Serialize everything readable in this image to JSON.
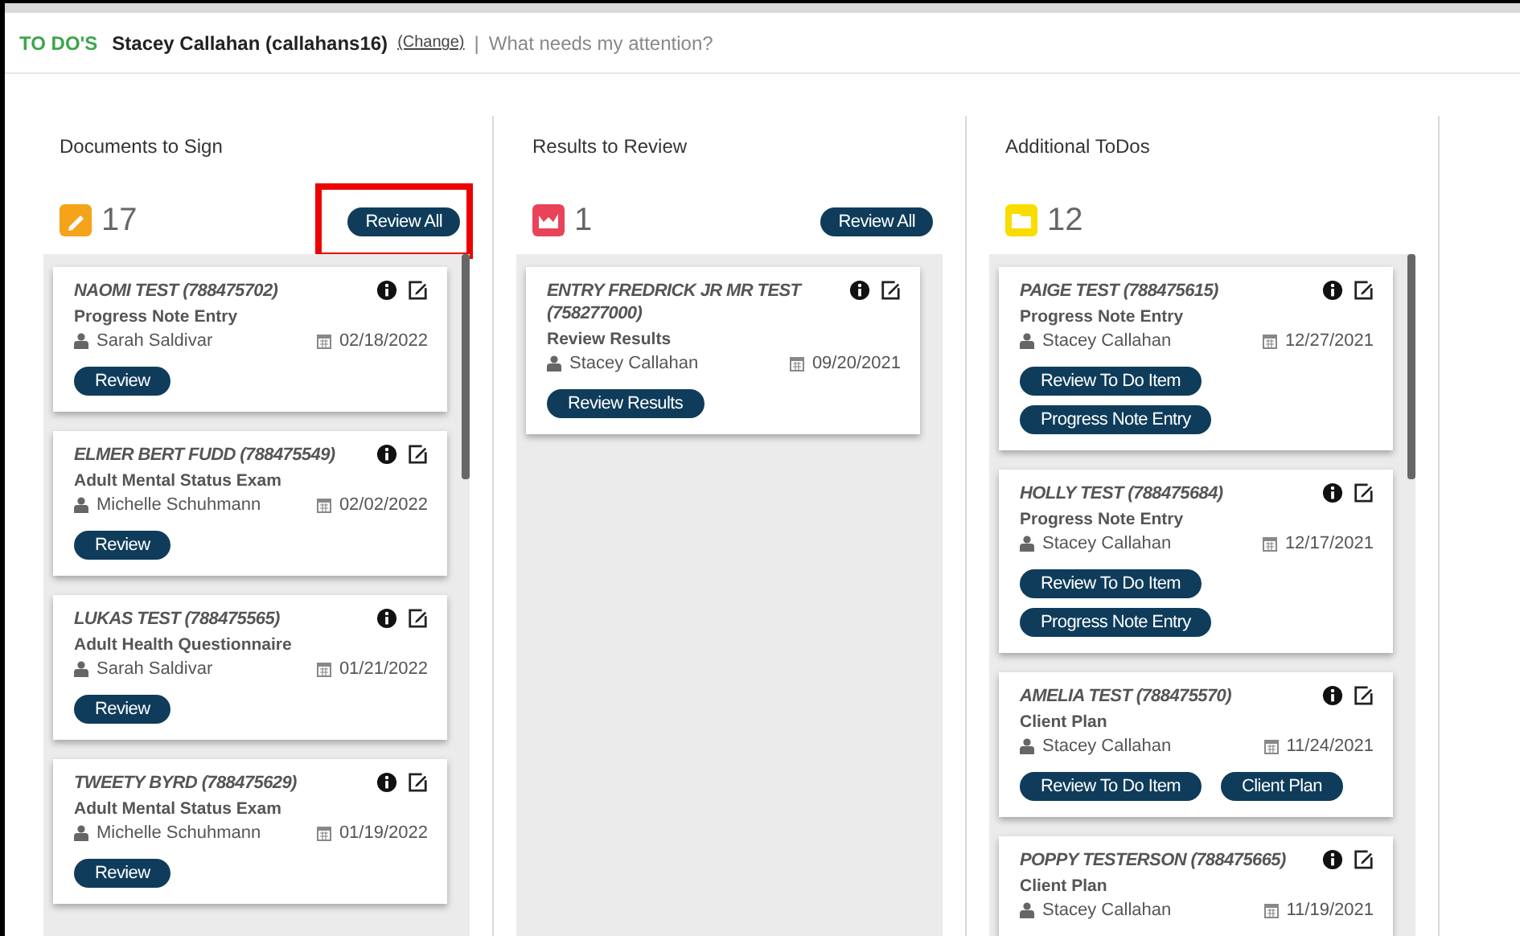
{
  "header": {
    "title": "TO DO'S",
    "user": "Stacey Callahan (callahans16)",
    "change_link": "(Change)",
    "separator": "|",
    "subtitle": "What needs my attention?"
  },
  "columns": [
    {
      "title": "Documents to Sign",
      "kind": "pencil",
      "color": "#f5a31a",
      "count": "17",
      "review_all": "Review All",
      "highlighted": true,
      "cards": [
        {
          "client": "NAOMI TEST (788475702)",
          "type": "Progress Note Entry",
          "staff": "Sarah Saldivar",
          "date": "02/18/2022",
          "buttons": [
            "Review"
          ]
        },
        {
          "client": "ELMER BERT FUDD (788475549)",
          "type": "Adult Mental Status Exam",
          "staff": "Michelle Schuhmann",
          "date": "02/02/2022",
          "buttons": [
            "Review"
          ]
        },
        {
          "client": "LUKAS TEST (788475565)",
          "type": "Adult Health Questionnaire",
          "staff": "Sarah Saldivar",
          "date": "01/21/2022",
          "buttons": [
            "Review"
          ]
        },
        {
          "client": "TWEETY BYRD (788475629)",
          "type": "Adult Mental Status Exam",
          "staff": "Michelle Schuhmann",
          "date": "01/19/2022",
          "buttons": [
            "Review"
          ]
        }
      ]
    },
    {
      "title": "Results to Review",
      "kind": "chart",
      "color": "#e9435a",
      "count": "1",
      "review_all": "Review All",
      "cards": [
        {
          "client": "ENTRY FREDRICK JR MR TEST (758277000)",
          "type": "Review Results",
          "staff": "Stacey Callahan",
          "date": "09/20/2021",
          "buttons": [
            "Review Results"
          ]
        }
      ]
    },
    {
      "title": "Additional ToDos",
      "kind": "folder",
      "color": "#f9dc00",
      "count": "12",
      "cards": [
        {
          "client": "PAIGE TEST (788475615)",
          "type": "Progress Note Entry",
          "staff": "Stacey Callahan",
          "date": "12/27/2021",
          "buttons": [
            "Review To Do Item",
            "Progress Note Entry"
          ]
        },
        {
          "client": "HOLLY TEST (788475684)",
          "type": "Progress Note Entry",
          "staff": "Stacey Callahan",
          "date": "12/17/2021",
          "buttons": [
            "Review To Do Item",
            "Progress Note Entry"
          ]
        },
        {
          "client": "AMELIA TEST (788475570)",
          "type": "Client Plan",
          "staff": "Stacey Callahan",
          "date": "11/24/2021",
          "buttons": [
            "Review To Do Item",
            "Client Plan"
          ]
        },
        {
          "client": "POPPY TESTERSON (788475665)",
          "type": "Client Plan",
          "staff": "Stacey Callahan",
          "date": "11/19/2021"
        }
      ]
    }
  ]
}
